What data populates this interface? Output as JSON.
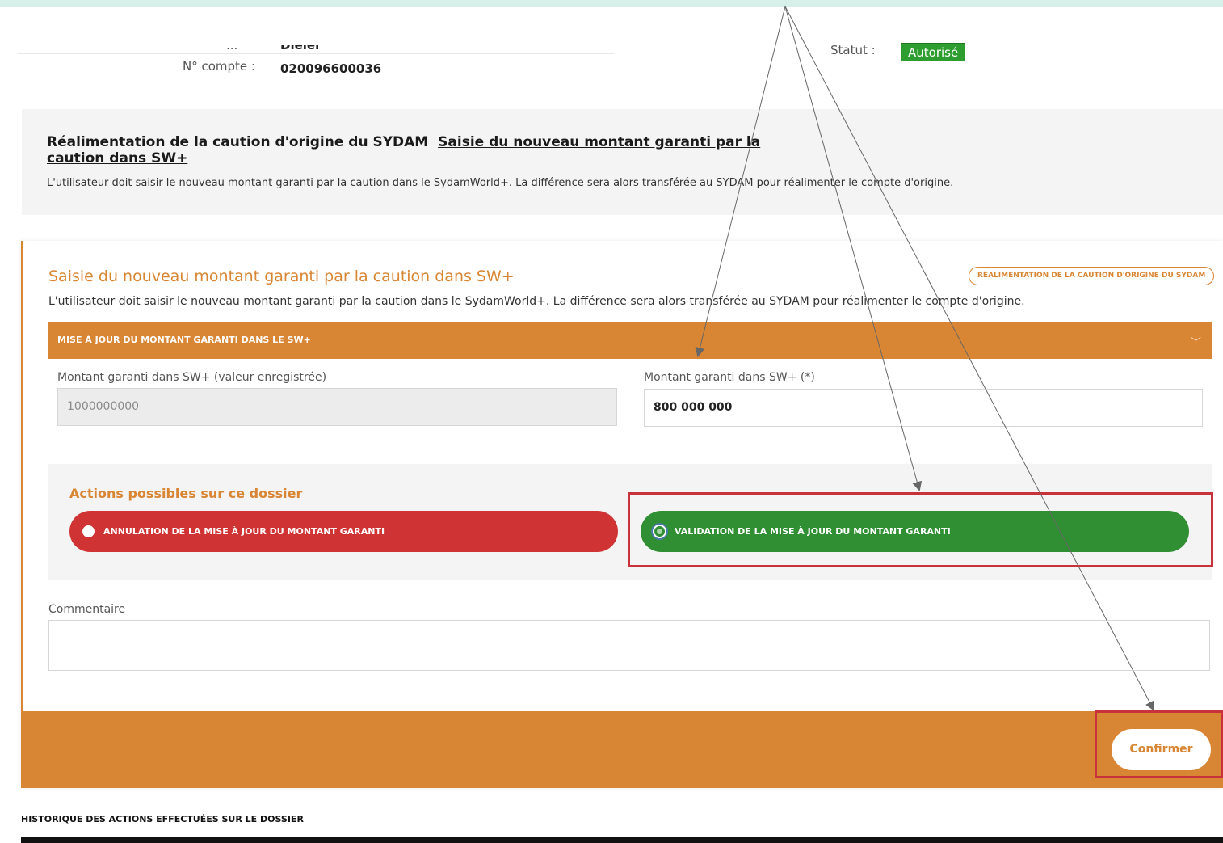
{
  "header": {
    "partial_label": "...",
    "partial_value": "Dielel",
    "account_label": "N° compte :",
    "account_value": "020096600036",
    "status_label": "Statut :",
    "status_value": "Autorisé"
  },
  "info": {
    "title": "Réalimentation de la caution d'origine du SYDAM",
    "title_link": "Saisie du nouveau montant garanti par la caution dans SW+",
    "description": "L'utilisateur doit saisir le nouveau montant garanti par la caution dans le SydamWorld+. La différence sera alors transférée au SYDAM pour réalimenter le compte d'origine."
  },
  "card": {
    "title": "Saisie du nouveau montant garanti par la caution dans SW+",
    "badge": "RÉALIMENTATION DE LA CAUTION D'ORIGINE DU SYDAM",
    "description": "L'utilisateur doit saisir le nouveau montant garanti par la caution dans le SydamWorld+. La différence sera alors transférée au SYDAM pour réalimenter le compte d'origine.",
    "section_label": "MISE À JOUR DU MONTANT GARANTI DANS LE SW+",
    "section_chevron": "﹀",
    "recorded_amount_label": "Montant garanti dans SW+ (valeur enregistrée)",
    "recorded_amount_value": "1000000000",
    "new_amount_label": "Montant garanti dans SW+ (*)",
    "new_amount_value": "800 000 000",
    "actions_title": "Actions possibles sur ce dossier",
    "action_cancel": "ANNULATION DE LA MISE À JOUR DU MONTANT GARANTI",
    "action_validate": "VALIDATION DE LA MISE À JOUR DU MONTANT GARANTI",
    "selected_action": "validate",
    "comment_label": "Commentaire",
    "comment_value": "",
    "confirm_label": "Confirmer"
  },
  "history": {
    "title": "HISTORIQUE DES ACTIONS EFFECTUÉES SUR LE DOSSIER"
  },
  "colors": {
    "accent_orange": "#d98634",
    "danger_red": "#cf3333",
    "success_green": "#2f8f32",
    "highlight_red": "#c8323a",
    "status_green": "#2d9d2f"
  },
  "icons": [
    "radio-unchecked-icon",
    "radio-checked-icon",
    "chevron-down-icon",
    "resize-grip-icon"
  ]
}
